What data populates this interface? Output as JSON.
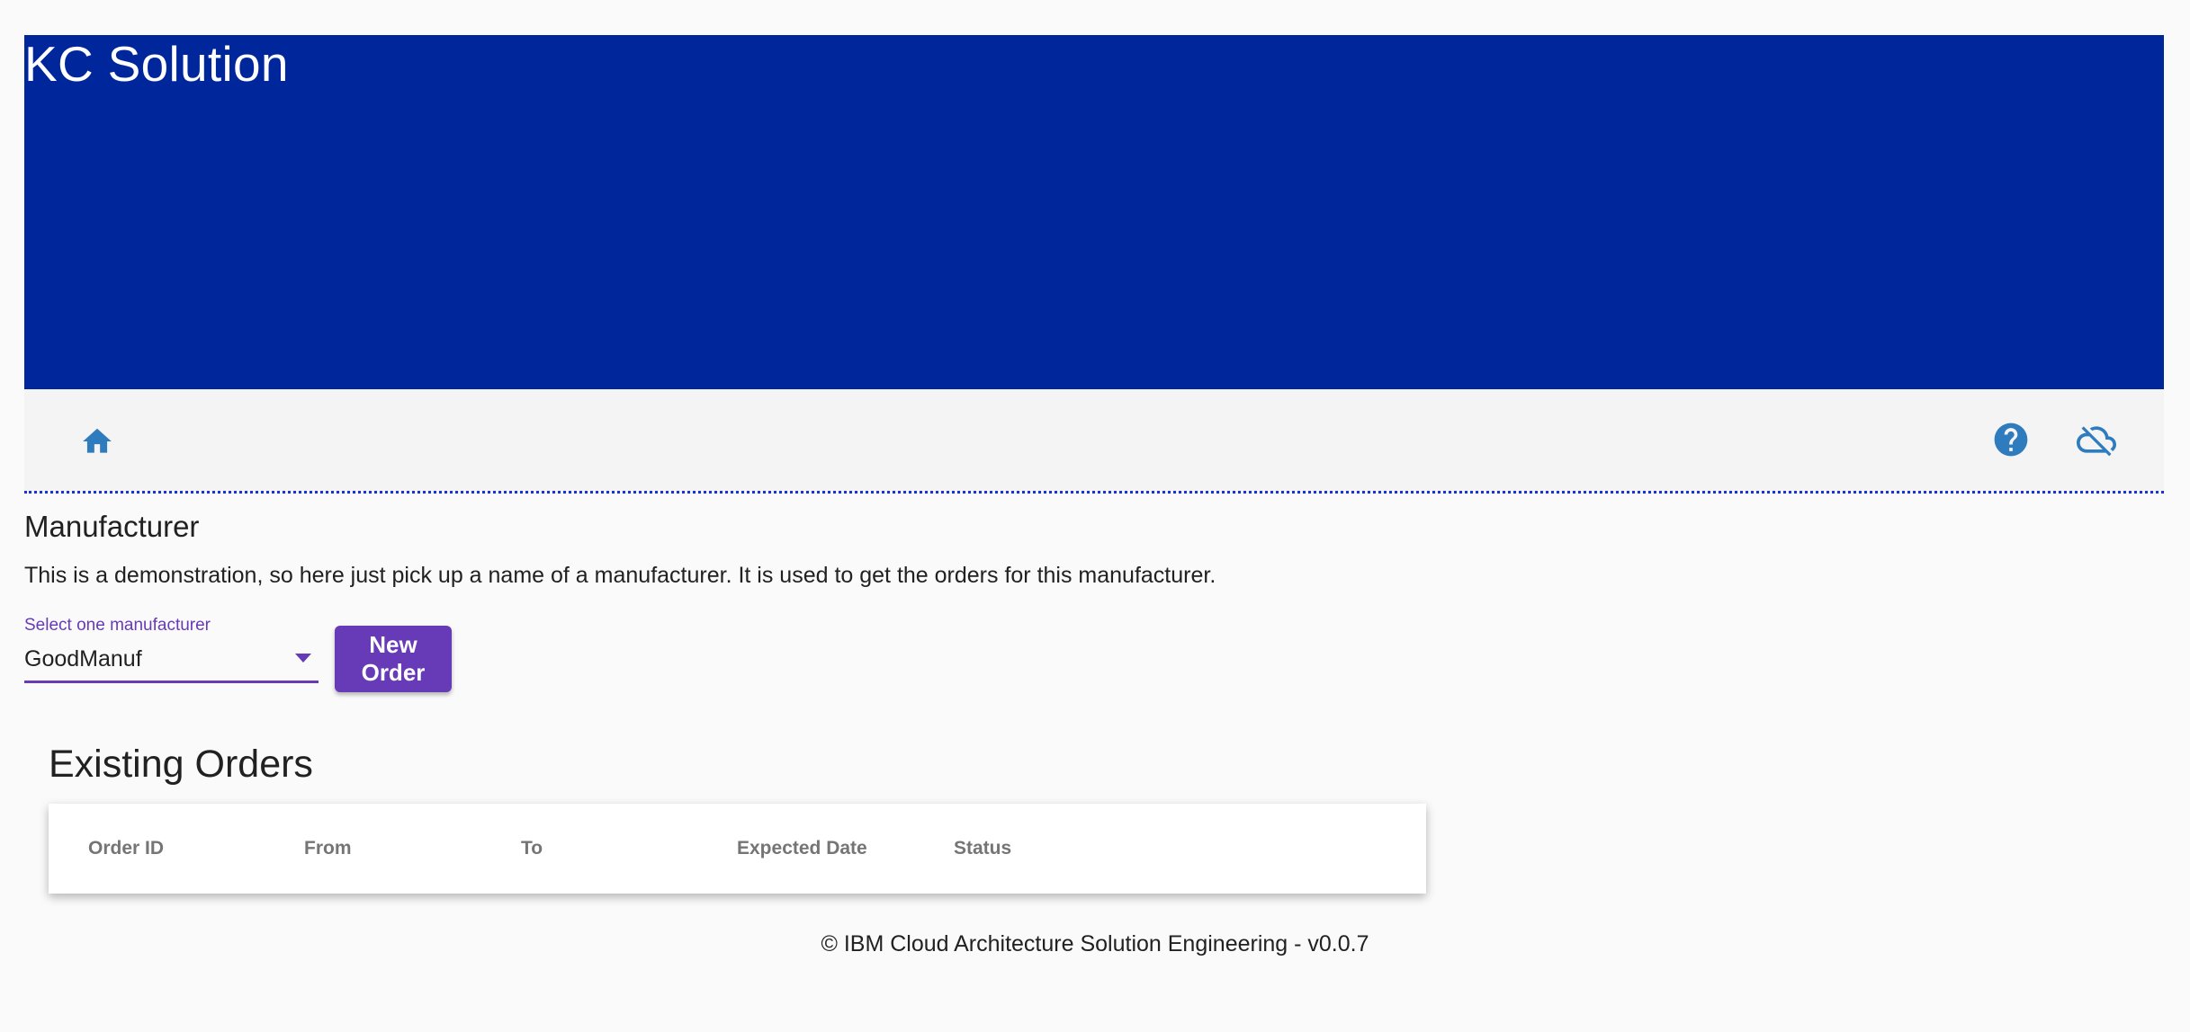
{
  "header": {
    "title": "KC Solution",
    "banner_color": "#00269b"
  },
  "toolbar": {
    "icons": [
      "home-icon",
      "help-icon",
      "cloud-off-icon"
    ],
    "icon_color": "#2e7bbd"
  },
  "manufacturer": {
    "heading": "Manufacturer",
    "description": "This is a demonstration, so here just pick up a name of a manufacturer. It is used to get the orders for this manufacturer.",
    "select_label": "Select one manufacturer",
    "selected_value": "GoodManuf",
    "new_order_label": "New Order",
    "accent_color": "#673ab7"
  },
  "orders": {
    "heading": "Existing Orders",
    "columns": [
      "Order ID",
      "From",
      "To",
      "Expected Date",
      "Status"
    ],
    "rows": []
  },
  "footer": {
    "text": "© IBM Cloud Architecture Solution Engineering - v0.0.7"
  }
}
